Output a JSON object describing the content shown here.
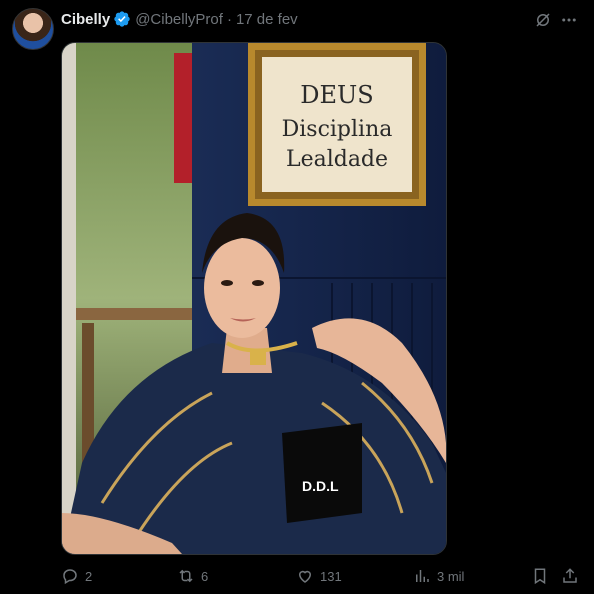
{
  "post": {
    "author_name": "Cibelly",
    "handle": "@CibellyProf",
    "separator": "·",
    "date": "17 de fev"
  },
  "media": {
    "sign_lines": [
      "DEUS",
      "Disciplina",
      "Lealdade"
    ],
    "shirt_text": "D.D.L"
  },
  "actions": {
    "replies": "2",
    "reposts": "6",
    "likes": "131",
    "views": "3 mil"
  },
  "icons": {
    "verified": "verified-badge-icon",
    "grok": "grok-icon",
    "more": "more-icon",
    "reply": "reply-icon",
    "retweet": "retweet-icon",
    "like": "heart-icon",
    "views": "views-icon",
    "bookmark": "bookmark-icon",
    "share": "share-icon"
  },
  "colors": {
    "background": "#000000",
    "text": "#e7e9ea",
    "muted": "#71767b",
    "verified": "#1d9bf0"
  }
}
